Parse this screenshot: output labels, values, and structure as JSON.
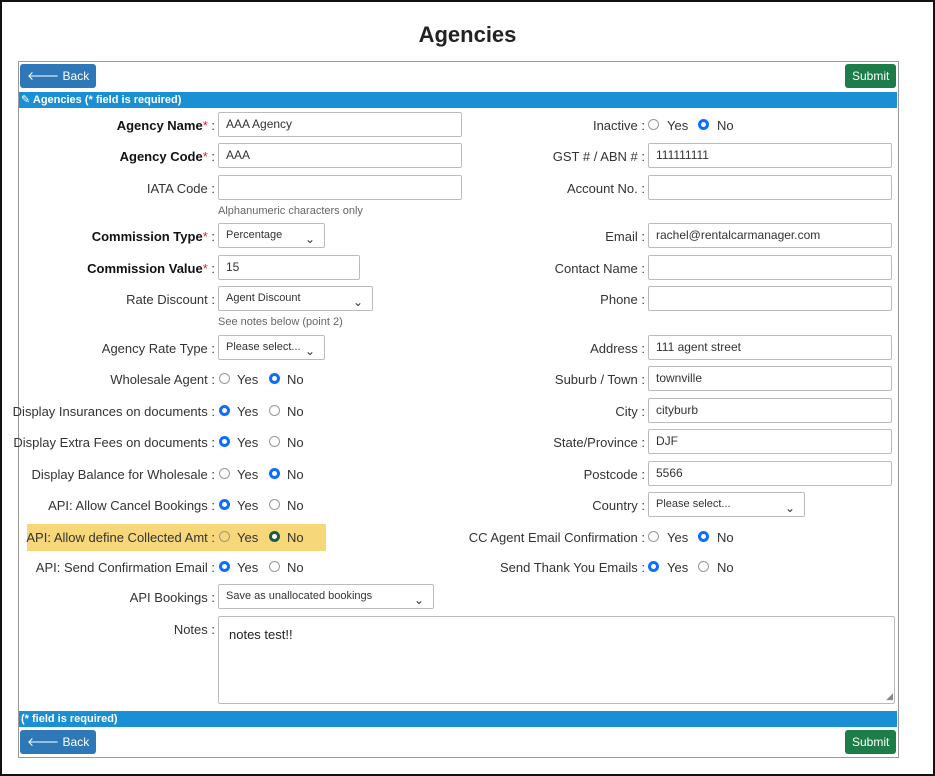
{
  "page_title": "Agencies",
  "buttons": {
    "back": "Back",
    "submit": "Submit"
  },
  "header_bar": "Agencies (* field is required)",
  "footer_bar": "(* field is required)",
  "colors": {
    "primary_bar": "#1b8fd3",
    "submit": "#1c7d48",
    "back": "#2e78b8",
    "highlight": "#f6d77a"
  },
  "radio_options": {
    "yes": "Yes",
    "no": "No"
  },
  "left": {
    "agency_name": {
      "label": "Agency Name",
      "value": "AAA Agency"
    },
    "agency_code": {
      "label": "Agency Code",
      "value": "AAA"
    },
    "iata_code": {
      "label": "IATA Code :",
      "value": "",
      "hint": "Alphanumeric characters only"
    },
    "commission_type": {
      "label": "Commission Type",
      "value": "Percentage"
    },
    "commission_value": {
      "label": "Commission Value",
      "value": "15"
    },
    "rate_discount": {
      "label": "Rate Discount :",
      "value": "Agent Discount",
      "hint": "See notes below (point 2)"
    },
    "agency_rate_type": {
      "label": "Agency Rate Type :",
      "value": "Please select..."
    },
    "wholesale_agent": {
      "label": "Wholesale Agent :",
      "selected": "No"
    },
    "display_insurances": {
      "label": "Display Insurances on documents :",
      "selected": "Yes"
    },
    "display_extra_fees": {
      "label": "Display Extra Fees on documents :",
      "selected": "Yes"
    },
    "display_balance": {
      "label": "Display Balance for Wholesale :",
      "selected": "No"
    },
    "api_allow_cancel": {
      "label": "API: Allow Cancel Bookings :",
      "selected": "Yes"
    },
    "api_allow_define": {
      "label": "API: Allow define Collected Amt :",
      "selected": "No"
    },
    "api_send_confirmation": {
      "label": "API: Send Confirmation Email :",
      "selected": "Yes"
    },
    "api_bookings": {
      "label": "API Bookings :",
      "value": "Save as unallocated bookings"
    },
    "notes": {
      "label": "Notes :",
      "value": "notes test!!"
    }
  },
  "right": {
    "inactive": {
      "label": "Inactive :",
      "selected": "No"
    },
    "gst": {
      "label": "GST # / ABN # :",
      "value": "111111111"
    },
    "account_no": {
      "label": "Account No. :",
      "value": ""
    },
    "email": {
      "label": "Email :",
      "value": "rachel@rentalcarmanager.com"
    },
    "contact_name": {
      "label": "Contact Name :",
      "value": ""
    },
    "phone": {
      "label": "Phone :",
      "value": ""
    },
    "address": {
      "label": "Address :",
      "value": "111 agent street"
    },
    "suburb": {
      "label": "Suburb / Town :",
      "value": "townville"
    },
    "city": {
      "label": "City :",
      "value": "cityburb"
    },
    "state": {
      "label": "State/Province :",
      "value": "DJF"
    },
    "postcode": {
      "label": "Postcode :",
      "value": "5566"
    },
    "country": {
      "label": "Country :",
      "value": "Please select..."
    },
    "cc_agent_email": {
      "label": "CC Agent Email Confirmation :",
      "selected": "No"
    },
    "send_thank_you": {
      "label": "Send Thank You Emails :",
      "selected": "Yes"
    }
  }
}
